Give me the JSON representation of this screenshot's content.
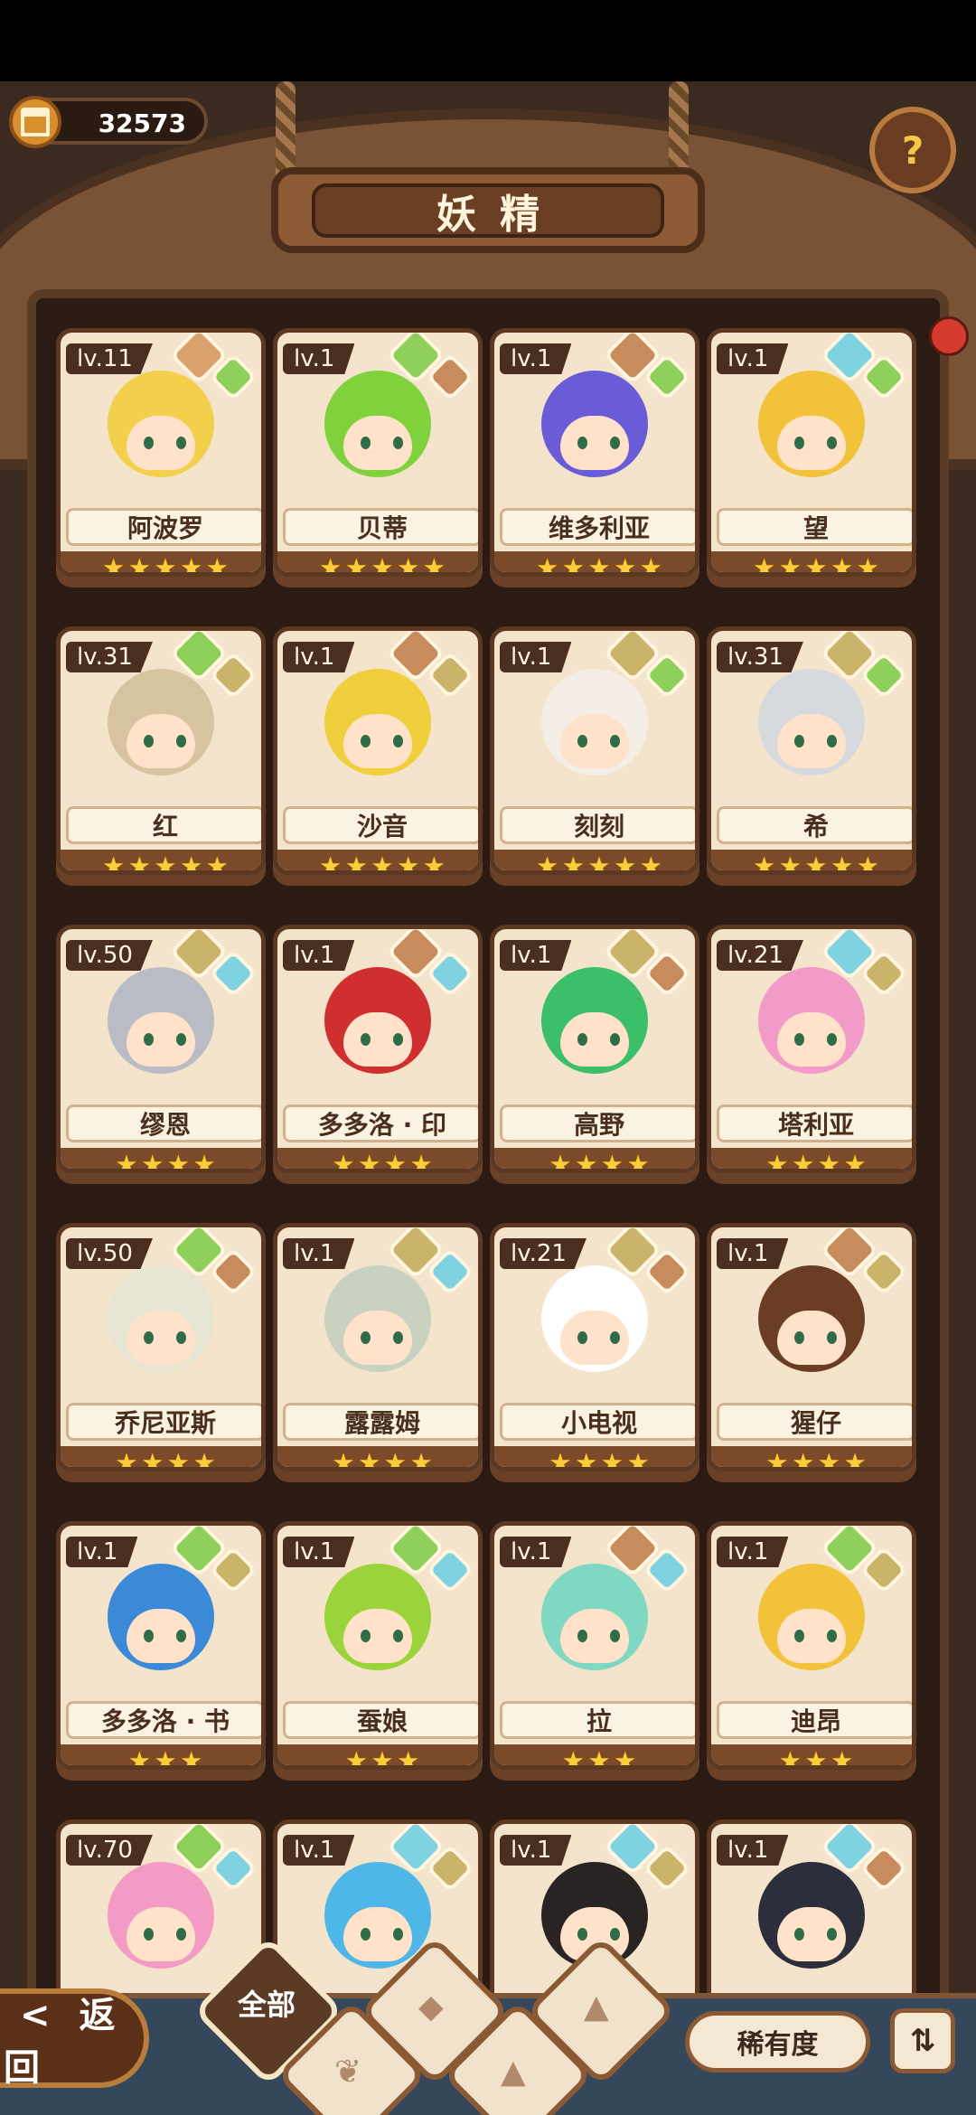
{
  "header": {
    "coins": "32573",
    "title": "妖精",
    "help_glyph": "?"
  },
  "fairies": [
    {
      "level": "lv.11",
      "name": "阿波罗",
      "stars": "★★★★★",
      "hair": "#f2d04b",
      "elements": [
        "#d9a26d",
        "#8fd05a"
      ]
    },
    {
      "level": "lv.1",
      "name": "贝蒂",
      "stars": "★★★★★",
      "hair": "#7fd23c",
      "elements": [
        "#8fd05a",
        "#c88b5c"
      ]
    },
    {
      "level": "lv.1",
      "name": "维多利亚",
      "stars": "★★★★★",
      "hair": "#6a5bd6",
      "elements": [
        "#c88b5c",
        "#8fd05a"
      ]
    },
    {
      "level": "lv.1",
      "name": "望",
      "stars": "★★★★★",
      "hair": "#f2c33a",
      "elements": [
        "#7fd3e0",
        "#8fd05a"
      ]
    },
    {
      "level": "lv.31",
      "name": "红",
      "stars": "★★★★★",
      "hair": "#d8c3a0",
      "elements": [
        "#8fd05a",
        "#c9b46a"
      ]
    },
    {
      "level": "lv.1",
      "name": "沙音",
      "stars": "★★★★★",
      "hair": "#f0cf3c",
      "elements": [
        "#c88b5c",
        "#c9b46a"
      ]
    },
    {
      "level": "lv.1",
      "name": "刻刻",
      "stars": "★★★★★",
      "hair": "#f5eee6",
      "elements": [
        "#c9b46a",
        "#8fd05a"
      ]
    },
    {
      "level": "lv.31",
      "name": "希",
      "stars": "★★★★★",
      "hair": "#d6d9de",
      "elements": [
        "#c9b46a",
        "#8fd05a"
      ]
    },
    {
      "level": "lv.50",
      "name": "缪恩",
      "stars": "★★★★",
      "hair": "#b9bcc4",
      "elements": [
        "#c9b46a",
        "#7fd3e0"
      ]
    },
    {
      "level": "lv.1",
      "name": "多多洛 · 印",
      "stars": "★★★★",
      "hair": "#d02f2f",
      "elements": [
        "#c88b5c",
        "#7fd3e0"
      ]
    },
    {
      "level": "lv.1",
      "name": "高野",
      "stars": "★★★★",
      "hair": "#3bbf6a",
      "elements": [
        "#c9b46a",
        "#c88b5c"
      ]
    },
    {
      "level": "lv.21",
      "name": "塔利亚",
      "stars": "★★★★",
      "hair": "#f29ac8",
      "elements": [
        "#7fd3e0",
        "#c9b46a"
      ]
    },
    {
      "level": "lv.50",
      "name": "乔尼亚斯",
      "stars": "★★★★",
      "hair": "#e6e6d2",
      "elements": [
        "#8fd05a",
        "#c88b5c"
      ]
    },
    {
      "level": "lv.1",
      "name": "露露姆",
      "stars": "★★★★",
      "hair": "#c9d2c0",
      "elements": [
        "#c9b46a",
        "#7fd3e0"
      ]
    },
    {
      "level": "lv.21",
      "name": "小电视",
      "stars": "★★★★",
      "hair": "#ffffff",
      "elements": [
        "#c9b46a",
        "#c88b5c"
      ]
    },
    {
      "level": "lv.1",
      "name": "猩仔",
      "stars": "★★★★",
      "hair": "#6b3d25",
      "elements": [
        "#c88b5c",
        "#c9b46a"
      ]
    },
    {
      "level": "lv.1",
      "name": "多多洛 · 书",
      "stars": "★★★",
      "hair": "#3b8ad8",
      "elements": [
        "#8fd05a",
        "#c9b46a"
      ]
    },
    {
      "level": "lv.1",
      "name": "蚕娘",
      "stars": "★★★",
      "hair": "#9bd43a",
      "elements": [
        "#8fd05a",
        "#7fd3e0"
      ]
    },
    {
      "level": "lv.1",
      "name": "拉",
      "stars": "★★★",
      "hair": "#7fd8c2",
      "elements": [
        "#c88b5c",
        "#7fd3e0"
      ]
    },
    {
      "level": "lv.1",
      "name": "迪昂",
      "stars": "★★★",
      "hair": "#f2c33a",
      "elements": [
        "#8fd05a",
        "#c9b46a"
      ]
    },
    {
      "level": "lv.70",
      "name": "",
      "stars": "",
      "hair": "#f39bc4",
      "elements": [
        "#8fd05a",
        "#7fd3e0"
      ]
    },
    {
      "level": "lv.1",
      "name": "",
      "stars": "",
      "hair": "#4fb7e8",
      "elements": [
        "#7fd3e0",
        "#c9b46a"
      ]
    },
    {
      "level": "lv.1",
      "name": "",
      "stars": "",
      "hair": "#2a2323",
      "elements": [
        "#7fd3e0",
        "#c9b46a"
      ]
    },
    {
      "level": "lv.1",
      "name": "",
      "stars": "",
      "hair": "#2c2f3b",
      "elements": [
        "#7fd3e0",
        "#c88b5c"
      ]
    }
  ],
  "bottom": {
    "back_label": "返回",
    "back_glyph": "<",
    "filter_all_label": "全部",
    "rarity_label": "稀有度",
    "sort_glyph": "⇅"
  }
}
